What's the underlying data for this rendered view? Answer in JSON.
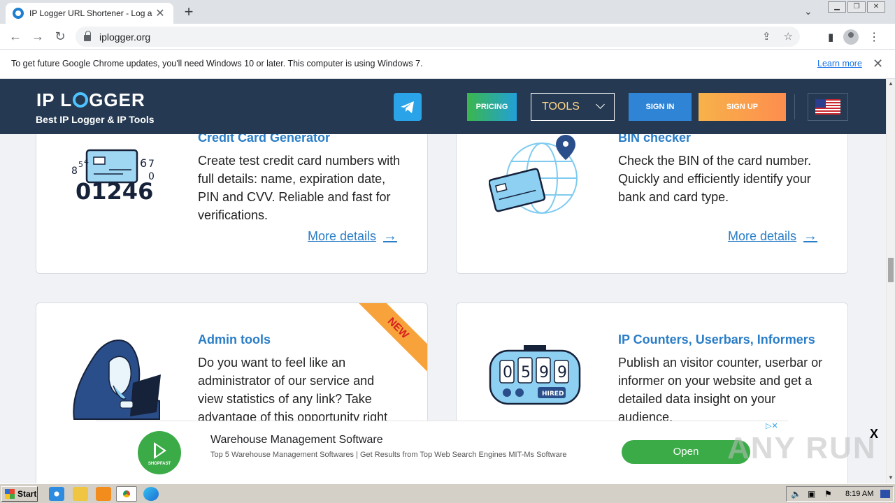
{
  "browser": {
    "tab_title": "IP Logger URL Shortener - Log and Track IP addresses",
    "url": "iplogger.org",
    "update_banner": "To get future Google Chrome updates, you'll need Windows 10 or later. This computer is using Windows 7.",
    "update_link": "Learn more"
  },
  "header": {
    "logo_left": "IP L",
    "logo_right": "GGER",
    "tagline": "Best IP Logger & IP Tools",
    "pricing": "PRICING",
    "tools": "TOOLS",
    "signin": "SIGN IN",
    "signup": "SIGN UP"
  },
  "cards": [
    {
      "title": "Credit Card Generator",
      "desc": "Create test credit card numbers with full details: name, expiration date, PIN and CVV. Reliable and fast for verifications.",
      "more": "More details",
      "illus_digits": "01246"
    },
    {
      "title": "BIN checker",
      "desc": "Check the BIN of the card number. Quickly and efficiently identify your bank and card type.",
      "more": "More details"
    },
    {
      "title": "Admin tools",
      "desc": "Do you want to feel like an administrator of our service and view statistics of any link? Take advantage of this opportunity right",
      "badge": "NEW"
    },
    {
      "title": "IP Counters, Userbars, Informers",
      "desc": "Publish an visitor counter, userbar or informer on your website and get a detailed data insight on your audience.",
      "counter_digits": [
        "0",
        "5",
        "9",
        "9"
      ],
      "counter_label": "HIRED"
    }
  ],
  "ad": {
    "logo_text": "SHOPFAST",
    "title": "Warehouse Management Software",
    "desc": "Top 5 Warehouse Management Softwares | Get Results from Top Web Search Engines MIT-Ms Software",
    "button": "Open",
    "close": "X"
  },
  "watermark": "ANY RUN",
  "taskbar": {
    "start": "Start",
    "clock": "8:19 AM"
  }
}
